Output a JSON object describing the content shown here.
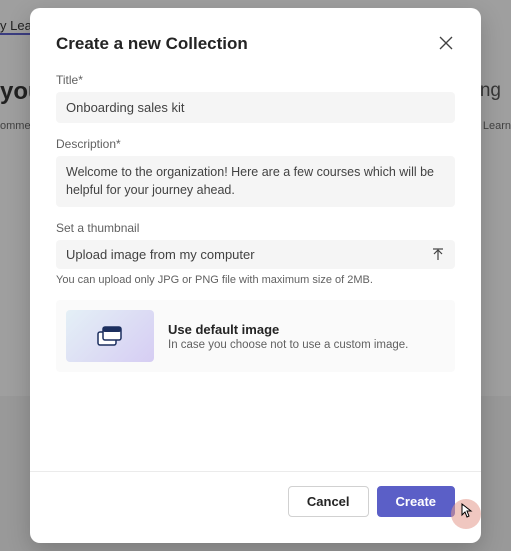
{
  "background": {
    "tab": "y Learn",
    "headline": "you",
    "rightWord": "ing",
    "leftSmall": "ommer",
    "rightSmall": "edIn Learn"
  },
  "modal": {
    "title": "Create a new Collection",
    "fields": {
      "titleLabel": "Title*",
      "titleValue": "Onboarding sales kit",
      "descLabel": "Description*",
      "descValue": "Welcome to the organization! Here are a few courses which will be helpful for your journey ahead.",
      "thumbLabel": "Set a thumbnail",
      "uploadText": "Upload image from my computer",
      "uploadHelper": "You can upload only JPG or PNG file with maximum size of 2MB."
    },
    "defaultCard": {
      "title": "Use default image",
      "subtitle": "In case you choose not to use a custom image."
    },
    "buttons": {
      "cancel": "Cancel",
      "create": "Create"
    }
  }
}
